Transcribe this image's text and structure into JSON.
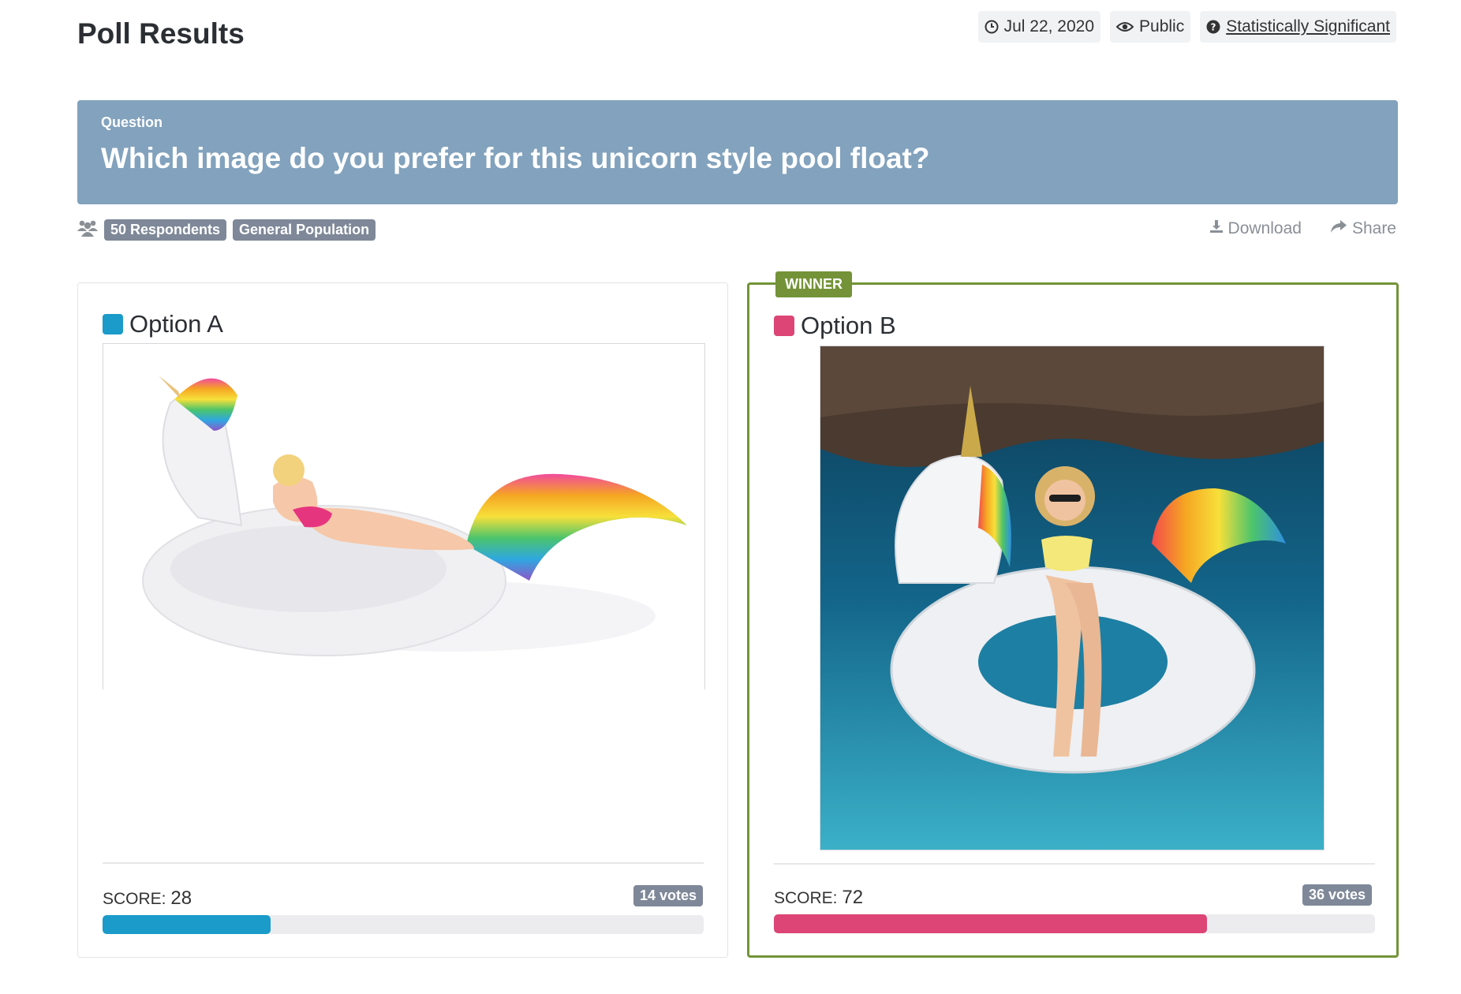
{
  "page": {
    "title": "Poll Results"
  },
  "meta": {
    "date": "Jul 22, 2020",
    "visibility": "Public",
    "significance": "Statistically Significant"
  },
  "question": {
    "label": "Question",
    "text": "Which image do you prefer for this unicorn style pool float?"
  },
  "info": {
    "respondents": "50 Respondents",
    "audience": "General Population",
    "download": "Download",
    "share": "Share"
  },
  "options": [
    {
      "name": "Option A",
      "color": "#1a9bc9",
      "score_label": "SCORE:",
      "score": "28",
      "votes": "14 votes",
      "fill_fraction": 0.28
    },
    {
      "name": "Option B",
      "color": "#dc4576",
      "score_label": "SCORE:",
      "score": "72",
      "votes": "36 votes",
      "fill_fraction": 0.72,
      "badge": "WINNER"
    }
  ]
}
